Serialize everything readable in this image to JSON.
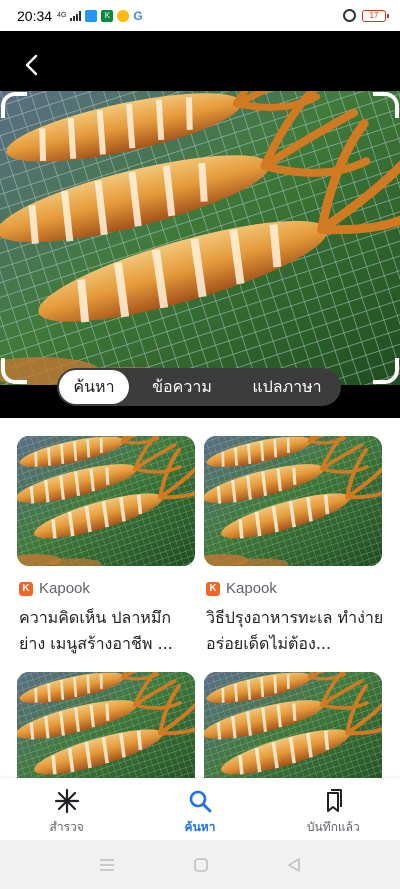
{
  "status_bar": {
    "time": "20:34",
    "network": "4G",
    "battery": "17",
    "google_letter": "G"
  },
  "lens": {
    "modes": [
      "ค้นหา",
      "ข้อความ",
      "แปลภาษา"
    ],
    "active_mode": "ค้นหา"
  },
  "results": [
    {
      "source": "Kapook",
      "title": "ความคิดเห็น ปลาหมึกย่าง เมนูสร้างอาชีพ ..."
    },
    {
      "source": "Kapook",
      "title": "วิธีปรุงอาหารทะเล ทำง่ายอร่อยเด็ดไม่ต้อง..."
    },
    {
      "source": "",
      "title": ""
    },
    {
      "source": "",
      "title": ""
    }
  ],
  "bottom_nav": {
    "items": [
      {
        "label": "สำรวจ",
        "icon": "asterisk-icon"
      },
      {
        "label": "ค้นหา",
        "icon": "search-icon"
      },
      {
        "label": "บันทึกแล้ว",
        "icon": "bookmarks-icon"
      }
    ],
    "active": "ค้นหา"
  },
  "colors": {
    "accent": "#1a73e8",
    "lens_background": "#000000",
    "source_logo": "#f26522"
  }
}
